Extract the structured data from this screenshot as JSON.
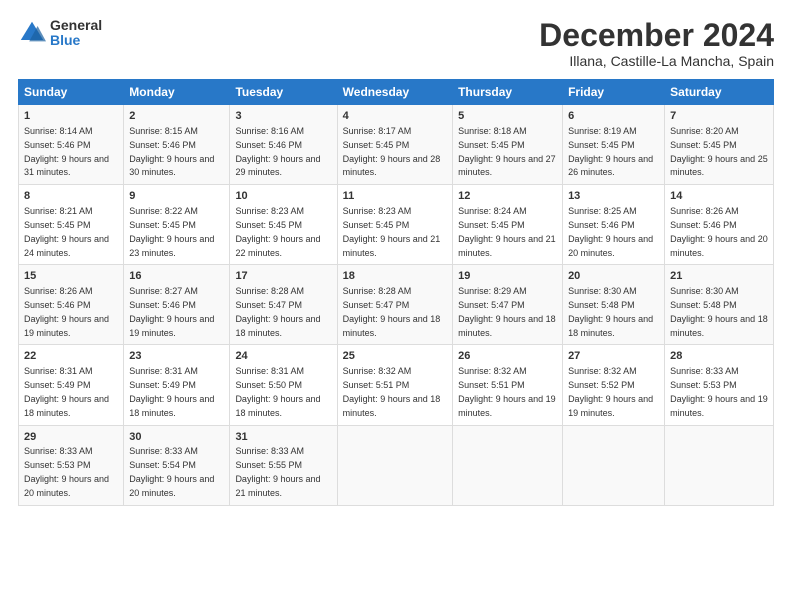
{
  "header": {
    "logo_general": "General",
    "logo_blue": "Blue",
    "title": "December 2024",
    "subtitle": "Illana, Castille-La Mancha, Spain"
  },
  "columns": [
    "Sunday",
    "Monday",
    "Tuesday",
    "Wednesday",
    "Thursday",
    "Friday",
    "Saturday"
  ],
  "weeks": [
    [
      {
        "day": "1",
        "sunrise": "8:14 AM",
        "sunset": "5:46 PM",
        "daylight": "9 hours and 31 minutes."
      },
      {
        "day": "2",
        "sunrise": "8:15 AM",
        "sunset": "5:46 PM",
        "daylight": "9 hours and 30 minutes."
      },
      {
        "day": "3",
        "sunrise": "8:16 AM",
        "sunset": "5:46 PM",
        "daylight": "9 hours and 29 minutes."
      },
      {
        "day": "4",
        "sunrise": "8:17 AM",
        "sunset": "5:45 PM",
        "daylight": "9 hours and 28 minutes."
      },
      {
        "day": "5",
        "sunrise": "8:18 AM",
        "sunset": "5:45 PM",
        "daylight": "9 hours and 27 minutes."
      },
      {
        "day": "6",
        "sunrise": "8:19 AM",
        "sunset": "5:45 PM",
        "daylight": "9 hours and 26 minutes."
      },
      {
        "day": "7",
        "sunrise": "8:20 AM",
        "sunset": "5:45 PM",
        "daylight": "9 hours and 25 minutes."
      }
    ],
    [
      {
        "day": "8",
        "sunrise": "8:21 AM",
        "sunset": "5:45 PM",
        "daylight": "9 hours and 24 minutes."
      },
      {
        "day": "9",
        "sunrise": "8:22 AM",
        "sunset": "5:45 PM",
        "daylight": "9 hours and 23 minutes."
      },
      {
        "day": "10",
        "sunrise": "8:23 AM",
        "sunset": "5:45 PM",
        "daylight": "9 hours and 22 minutes."
      },
      {
        "day": "11",
        "sunrise": "8:23 AM",
        "sunset": "5:45 PM",
        "daylight": "9 hours and 21 minutes."
      },
      {
        "day": "12",
        "sunrise": "8:24 AM",
        "sunset": "5:45 PM",
        "daylight": "9 hours and 21 minutes."
      },
      {
        "day": "13",
        "sunrise": "8:25 AM",
        "sunset": "5:46 PM",
        "daylight": "9 hours and 20 minutes."
      },
      {
        "day": "14",
        "sunrise": "8:26 AM",
        "sunset": "5:46 PM",
        "daylight": "9 hours and 20 minutes."
      }
    ],
    [
      {
        "day": "15",
        "sunrise": "8:26 AM",
        "sunset": "5:46 PM",
        "daylight": "9 hours and 19 minutes."
      },
      {
        "day": "16",
        "sunrise": "8:27 AM",
        "sunset": "5:46 PM",
        "daylight": "9 hours and 19 minutes."
      },
      {
        "day": "17",
        "sunrise": "8:28 AM",
        "sunset": "5:47 PM",
        "daylight": "9 hours and 18 minutes."
      },
      {
        "day": "18",
        "sunrise": "8:28 AM",
        "sunset": "5:47 PM",
        "daylight": "9 hours and 18 minutes."
      },
      {
        "day": "19",
        "sunrise": "8:29 AM",
        "sunset": "5:47 PM",
        "daylight": "9 hours and 18 minutes."
      },
      {
        "day": "20",
        "sunrise": "8:30 AM",
        "sunset": "5:48 PM",
        "daylight": "9 hours and 18 minutes."
      },
      {
        "day": "21",
        "sunrise": "8:30 AM",
        "sunset": "5:48 PM",
        "daylight": "9 hours and 18 minutes."
      }
    ],
    [
      {
        "day": "22",
        "sunrise": "8:31 AM",
        "sunset": "5:49 PM",
        "daylight": "9 hours and 18 minutes."
      },
      {
        "day": "23",
        "sunrise": "8:31 AM",
        "sunset": "5:49 PM",
        "daylight": "9 hours and 18 minutes."
      },
      {
        "day": "24",
        "sunrise": "8:31 AM",
        "sunset": "5:50 PM",
        "daylight": "9 hours and 18 minutes."
      },
      {
        "day": "25",
        "sunrise": "8:32 AM",
        "sunset": "5:51 PM",
        "daylight": "9 hours and 18 minutes."
      },
      {
        "day": "26",
        "sunrise": "8:32 AM",
        "sunset": "5:51 PM",
        "daylight": "9 hours and 19 minutes."
      },
      {
        "day": "27",
        "sunrise": "8:32 AM",
        "sunset": "5:52 PM",
        "daylight": "9 hours and 19 minutes."
      },
      {
        "day": "28",
        "sunrise": "8:33 AM",
        "sunset": "5:53 PM",
        "daylight": "9 hours and 19 minutes."
      }
    ],
    [
      {
        "day": "29",
        "sunrise": "8:33 AM",
        "sunset": "5:53 PM",
        "daylight": "9 hours and 20 minutes."
      },
      {
        "day": "30",
        "sunrise": "8:33 AM",
        "sunset": "5:54 PM",
        "daylight": "9 hours and 20 minutes."
      },
      {
        "day": "31",
        "sunrise": "8:33 AM",
        "sunset": "5:55 PM",
        "daylight": "9 hours and 21 minutes."
      },
      null,
      null,
      null,
      null
    ]
  ],
  "labels": {
    "sunrise": "Sunrise:",
    "sunset": "Sunset:",
    "daylight": "Daylight:"
  }
}
